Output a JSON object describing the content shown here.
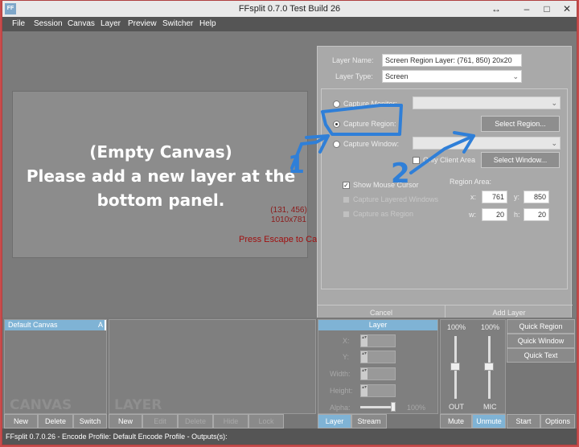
{
  "window": {
    "title": "FFsplit 0.7.0 Test Build 26",
    "icon_text": "FF",
    "controls": {
      "resize": "↔",
      "minimize": "–",
      "maximize": "□",
      "close": "✕"
    }
  },
  "menu": [
    "File",
    "Session",
    "Canvas",
    "Layer",
    "Preview",
    "Switcher",
    "Help"
  ],
  "canvas": {
    "empty_line1": "(Empty Canvas)",
    "empty_line2": "Please add a new layer at the",
    "empty_line3": "bottom panel.",
    "coords": "(131, 456)",
    "size": "1010x781",
    "escape_hint": "Press Escape to Cancel."
  },
  "layer_panel": {
    "layer_name_label": "Layer Name:",
    "layer_name_value": "Screen Region Layer: (761, 850) 20x20",
    "layer_type_label": "Layer Type:",
    "layer_type_value": "Screen",
    "capture_monitor": "Capture Monitor:",
    "capture_region": "Capture Region:",
    "capture_window": "Capture Window:",
    "select_region": "Select Region...",
    "only_client_area": "Only Client Area",
    "select_window": "Select Window...",
    "show_mouse_cursor": "Show Mouse Cursor",
    "capture_layered_windows": "Capture Layered Windows",
    "capture_as_region": "Capture as Region",
    "region_area_label": "Region Area:",
    "x_label": "x:",
    "y_label": "y:",
    "w_label": "w:",
    "h_label": "h:",
    "x_value": "761",
    "y_value": "850",
    "w_value": "20",
    "h_value": "20",
    "cancel": "Cancel",
    "add_layer": "Add Layer"
  },
  "annotations": {
    "one": "1",
    "two": "2"
  },
  "canvas_list": {
    "items": [
      {
        "label": "Default Canvas",
        "badge": "A"
      }
    ],
    "watermark": "CANVAS",
    "buttons": {
      "new": "New",
      "delete": "Delete",
      "switch": "Switch"
    }
  },
  "layer_list": {
    "watermark": "LAYER",
    "buttons": {
      "new": "New",
      "edit": "Edit",
      "delete": "Delete",
      "hide": "Hide",
      "lock": "Lock"
    }
  },
  "properties": {
    "header": "Layer",
    "x_label": "X:",
    "y_label": "Y:",
    "width_label": "Width:",
    "height_label": "Height:",
    "alpha_label": "Alpha:",
    "alpha_value": "100%",
    "tabs": {
      "layer": "Layer",
      "stream": "Stream"
    }
  },
  "audio": {
    "out_level": "100%",
    "mic_level": "100%",
    "out_label": "OUT",
    "mic_label": "MIC",
    "mute": "Mute",
    "unmute": "Unmute"
  },
  "quick": {
    "region": "Quick Region",
    "window": "Quick Window",
    "text": "Quick Text",
    "start": "Start",
    "options": "Options"
  },
  "status_bar": "FFsplit 0.7.0.26 - Encode Profile: Default Encode Profile - Outputs(s):",
  "colors": {
    "accent": "#7fb3d5",
    "annotation": "#2f7fd8",
    "window_border": "#c94b4b"
  }
}
